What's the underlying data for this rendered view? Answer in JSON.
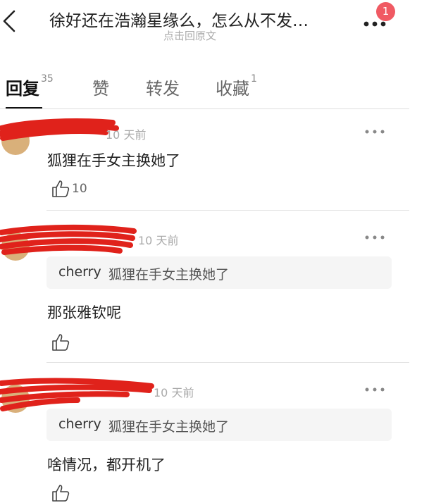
{
  "header": {
    "title": "徐好还在浩瀚星缘么，怎么从不发…",
    "subtitle": "点击回原文",
    "badge": "1"
  },
  "tabs": [
    {
      "label": "回复",
      "count": "35"
    },
    {
      "label": "赞",
      "count": ""
    },
    {
      "label": "转发",
      "count": ""
    },
    {
      "label": "收藏",
      "count": "1"
    }
  ],
  "comments": [
    {
      "time": "10 天前",
      "text": "狐狸在手女主换她了",
      "likes": "10"
    },
    {
      "time": "10 天前",
      "quote_name": "cherry",
      "quote_text": "狐狸在手女主换她了",
      "text": "那张雅钦呢",
      "likes": ""
    },
    {
      "time": "10 天前",
      "quote_name": "cherry",
      "quote_text": "狐狸在手女主换她了",
      "text": "啥情况，都开机了",
      "likes": ""
    }
  ],
  "colors": {
    "badge": "#f05a63",
    "redaction": "#e0221b"
  }
}
